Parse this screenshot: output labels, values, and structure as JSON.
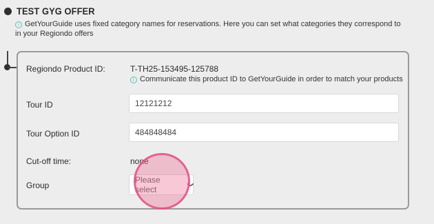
{
  "section": {
    "title": "TEST GYG OFFER",
    "info": "GetYourGuide uses fixed category names for reservations. Here you can set what categories they correspond to in your Regiondo offers"
  },
  "product": {
    "label": "Regiondo Product ID:",
    "value": "T-TH25-153495-125788",
    "hint": "Communicate this product ID to GetYourGuide in order to match your products"
  },
  "tour_id": {
    "label": "Tour ID",
    "value": "12121212"
  },
  "tour_option_id": {
    "label": "Tour Option ID",
    "value": "484848484"
  },
  "cutoff": {
    "label": "Cut-off time:",
    "value": "none"
  },
  "group": {
    "label": "Group",
    "selected": "Please select"
  },
  "colors": {
    "info_icon": "#58c3b8",
    "touch_indicator": "#e25082"
  }
}
